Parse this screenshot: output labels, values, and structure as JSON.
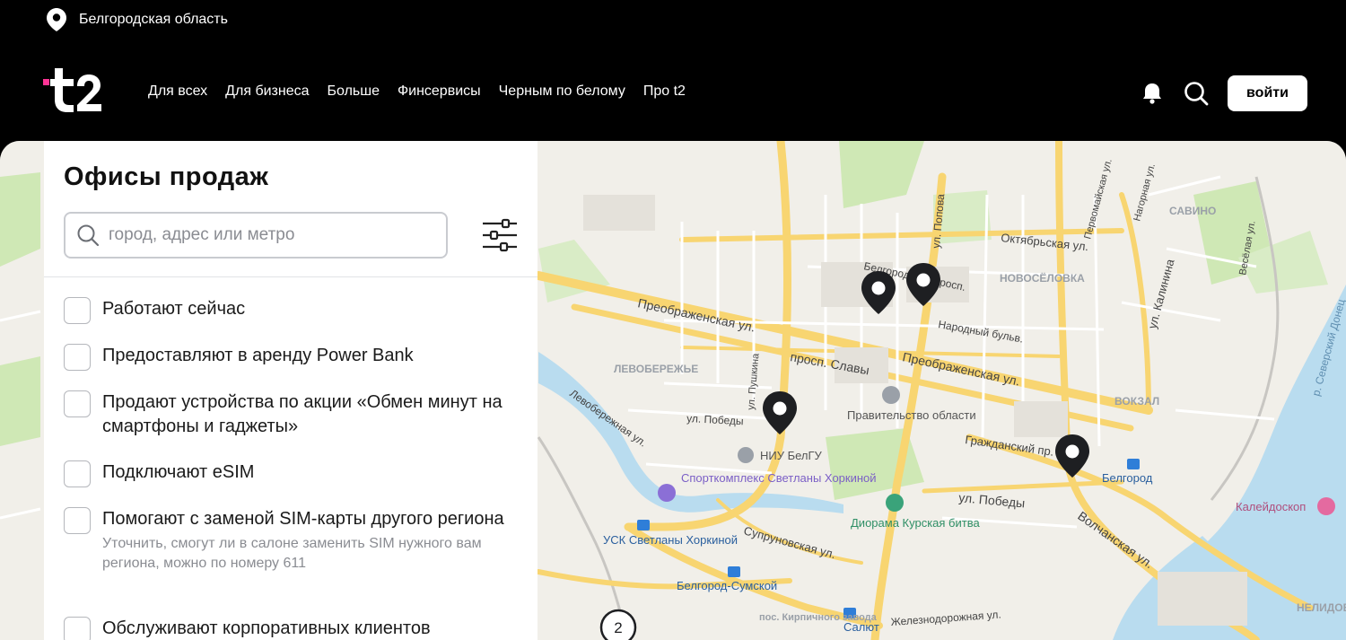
{
  "header": {
    "region": "Белгородская область",
    "nav": [
      "Для всех",
      "Для бизнеса",
      "Больше",
      "Финсервисы",
      "Черным по белому",
      "Про t2"
    ],
    "login": "войти"
  },
  "panel": {
    "title": "Офисы продаж",
    "search_placeholder": "город, адрес или метро",
    "options": [
      {
        "label": "Работают сейчас"
      },
      {
        "label": "Предоставляют в аренду Power Bank"
      },
      {
        "label": "Продают устройства по акции «Обмен минут на смартфоны и гаджеты»"
      },
      {
        "label": "Подключают eSIM"
      },
      {
        "label": "Помогают с заменой SIM-карты другого региона",
        "sub": "Уточнить, смогут ли в салоне заменить SIM нужного вам региона, можно по номеру 611"
      },
      {
        "label": "Обслуживают корпоративных клиентов"
      }
    ]
  },
  "map": {
    "labels": {
      "street1": "Преображенская ул.",
      "street2": "Преображенская ул.",
      "street3": "просп. Славы",
      "street4": "Октябрьская ул.",
      "street5": "Народный бульв.",
      "street6": "ул. Победы",
      "street7": "ул. Победы",
      "street8": "Гражданский пр.",
      "street9": "Супруновская ул.",
      "street10": "Волчанская ул.",
      "street11": "Железнодорожная ул.",
      "street12": "Левобережная ул.",
      "street13": "ул. Калинина",
      "street14": "ул. Попова",
      "street15": "ул. Пушкина",
      "street16": "Первомайская ул.",
      "street17": "Нагорная ул.",
      "street18": "Весёлая ул.",
      "street19": "р. Северский Донец",
      "street20": "Белгородский просп.",
      "district1": "НОВОСЁЛОВКА",
      "district2": "ЛЕВОБЕРЕЖЬЕ",
      "district3": "САВИНО",
      "district4": "ВОКЗАЛ",
      "district5": "НЕЛИДОВ",
      "poi1": "Правительство области",
      "poi2": "НИУ БелГУ",
      "poi3": "Спорткомплекс Светланы Хоркиной",
      "poi4": "Диорама Курская битва",
      "poi5": "УСК Светланы Хоркиной",
      "poi6": "Белгород",
      "poi7": "Белгород-Сумской",
      "poi8": "Калейдоскоп",
      "poi9": "Салют",
      "poi10": "пос. Кирпичного завода",
      "cluster": "2"
    }
  },
  "colors": {
    "accent": "#ff3495",
    "road": "#f8d571",
    "water": "#b9dcef",
    "park": "#cfe8b5"
  }
}
